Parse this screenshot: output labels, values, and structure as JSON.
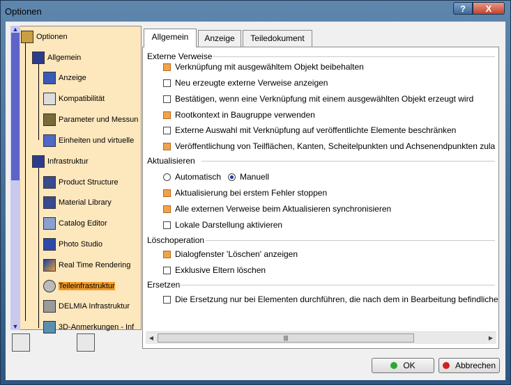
{
  "window": {
    "title": "Optionen",
    "help_label": "?",
    "close_label": "X"
  },
  "tree": {
    "items": [
      {
        "label": "Optionen"
      },
      {
        "label": "Allgemein"
      },
      {
        "label": "Anzeige"
      },
      {
        "label": "Kompatibilität"
      },
      {
        "label": "Parameter und Messun"
      },
      {
        "label": "Einheiten und virtuelle"
      },
      {
        "label": "Infrastruktur"
      },
      {
        "label": "Product Structure"
      },
      {
        "label": "Material Library"
      },
      {
        "label": "Catalog Editor"
      },
      {
        "label": "Photo Studio"
      },
      {
        "label": "Real Time Rendering"
      },
      {
        "label": "Teileinfrastruktur"
      },
      {
        "label": "DELMIA Infrastruktur"
      },
      {
        "label": "3D-Anmerkungen - Inf"
      }
    ],
    "selected": "Teileinfrastruktur"
  },
  "tabs": [
    {
      "label": "Allgemein"
    },
    {
      "label": "Anzeige"
    },
    {
      "label": "Teiledokument"
    }
  ],
  "sections": {
    "externe": {
      "title": "Externe Verweise",
      "options": [
        {
          "label": "Verknüpfung mit ausgewähltem Objekt beibehalten",
          "checked": true
        },
        {
          "label": "Neu erzeugte externe Verweise anzeigen",
          "checked": false
        },
        {
          "label": "Bestätigen, wenn eine Verknüpfung mit einem ausgewählten Objekt erzeugt wird",
          "checked": false
        },
        {
          "label": "Rootkontext in Baugruppe verwenden",
          "checked": true
        },
        {
          "label": "Externe Auswahl mit Verknüpfung auf veröffentlichte Elemente beschränken",
          "checked": false
        },
        {
          "label": "Veröffentlichung von Teilflächen, Kanten, Scheitelpunkten und Achsenendpunkten zula",
          "checked": true
        }
      ]
    },
    "aktualisieren": {
      "title": "Aktualisieren",
      "radio_auto": "Automatisch",
      "radio_manual": "Manuell",
      "selected": "Manuell",
      "options": [
        {
          "label": "Aktualisierung bei erstem Fehler stoppen",
          "checked": true
        },
        {
          "label": "Alle externen Verweise beim Aktualisieren synchronisieren",
          "checked": true
        },
        {
          "label": "Lokale Darstellung aktivieren",
          "checked": false
        }
      ]
    },
    "loeschen": {
      "title": "Löschoperation",
      "options": [
        {
          "label": "Dialogfenster 'Löschen' anzeigen",
          "checked": true
        },
        {
          "label": "Exklusive Eltern löschen",
          "checked": false
        }
      ]
    },
    "ersetzen": {
      "title": "Ersetzen",
      "options": [
        {
          "label": "Die Ersetzung nur bei Elementen durchführen, die nach dem in Bearbeitung befindliche",
          "checked": false
        }
      ]
    }
  },
  "buttons": {
    "ok": "OK",
    "cancel": "Abbrechen"
  },
  "colors": {
    "checked": "#f3a24a",
    "selection": "#f39c2a",
    "tree_bg": "#fde7bd",
    "ok_led": "#2ea82e",
    "cancel_led": "#d02020"
  }
}
